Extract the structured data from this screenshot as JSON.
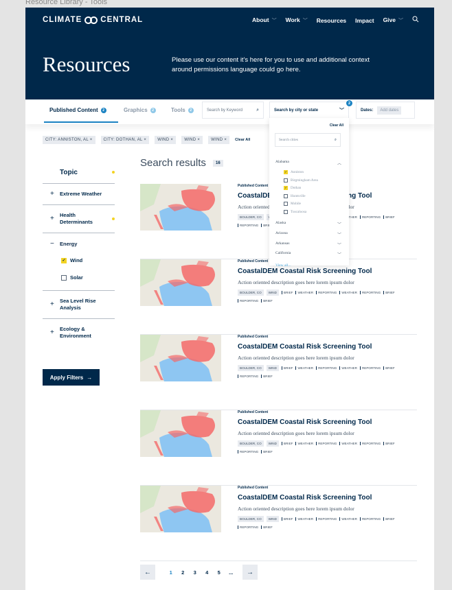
{
  "frame_label": "Resource Library - Tools",
  "header": {
    "logo_left": "CLIMATE",
    "logo_right": "CENTRAL",
    "nav": [
      {
        "label": "About",
        "has_dropdown": true
      },
      {
        "label": "Work",
        "has_dropdown": true
      },
      {
        "label": "Resources",
        "has_dropdown": false
      },
      {
        "label": "Impact",
        "has_dropdown": false
      },
      {
        "label": "Give",
        "has_dropdown": true
      }
    ],
    "search_icon": "search-icon",
    "title": "Resources",
    "description": "Please use our content it's here for you to use and additional context around permissions language could go here."
  },
  "tabs": [
    {
      "label": "Published Content",
      "count": "2",
      "active": true
    },
    {
      "label": "Graphics",
      "count": "2",
      "active": false
    },
    {
      "label": "Tools",
      "count": "2",
      "active": false
    }
  ],
  "filters_bar": {
    "keyword_placeholder": "Search by Keyword",
    "city_label": "Search by city or state",
    "city_count": "2",
    "dates_label": "Dates:",
    "dates_placeholder": "Add dates"
  },
  "active_chips": [
    "CITY: ANNISTON, AL ×",
    "CITY: DOTHAN, AL ×",
    "WIND ×",
    "WIND ×",
    "WIND ×"
  ],
  "clear_all_label": "Clear All",
  "city_dropdown": {
    "clear_all": "Clear All",
    "search_placeholder": "Search cities",
    "expanded_state": "Alabama",
    "cities": [
      {
        "label": "Anniston",
        "checked": true
      },
      {
        "label": "Birgmingham Area",
        "checked": false
      },
      {
        "label": "Dothan",
        "checked": true
      },
      {
        "label": "Huntsville",
        "checked": false
      },
      {
        "label": "Mobile",
        "checked": false
      },
      {
        "label": "Tuscaloosa",
        "checked": false
      }
    ],
    "collapsed_states": [
      "Alaska",
      "Arizona",
      "Arkansas",
      "California"
    ],
    "view_all": "View all..."
  },
  "sidebar": {
    "heading": "Topic",
    "categories": [
      {
        "label": "Extreme Weather",
        "has_selection": false
      },
      {
        "label": "Health Determinants",
        "has_selection": true
      }
    ],
    "energy": {
      "label": "Energy",
      "options": [
        {
          "label": "Wind",
          "checked": true
        },
        {
          "label": "Solar",
          "checked": false
        }
      ]
    },
    "categories_after": [
      {
        "label": "Sea Level Rise Analysis"
      },
      {
        "label": "Ecology & Environment"
      }
    ],
    "apply_label": "Apply Filters"
  },
  "results": {
    "title": "Search results",
    "count": "16",
    "items": [
      {
        "type": "Published Content",
        "title": "CoastalDEM Coastal Risk Screening Tool",
        "description": "Action oriented description goes here lorem ipsum dolor",
        "boxed_tags": [
          "BOULDER, CO",
          "WIND"
        ],
        "line_tags": [
          "BRIEF",
          "WEATHER",
          "REPORTING",
          "WEATHER",
          "REPORTING",
          "BRIEF",
          "REPORTING",
          "BRIEF"
        ]
      },
      {
        "type": "Published Content",
        "title": "CoastalDEM Coastal Risk Screening Tool",
        "description": "Action oriented description goes here lorem ipsum dolor",
        "boxed_tags": [
          "BOULDER, CO",
          "WIND"
        ],
        "line_tags": [
          "BRIEF",
          "WEATHER",
          "REPORTING",
          "WEATHER",
          "REPORTING",
          "BRIEF",
          "REPORTING",
          "BRIEF"
        ]
      },
      {
        "type": "Published Content",
        "title": "CoastalDEM Coastal Risk Screening Tool",
        "description": "Action oriented description goes here lorem ipsum dolor",
        "boxed_tags": [
          "BOULDER, CO",
          "WIND"
        ],
        "line_tags": [
          "BRIEF",
          "WEATHER",
          "REPORTING",
          "WEATHER",
          "REPORTING",
          "BRIEF",
          "REPORTING",
          "BRIEF"
        ]
      },
      {
        "type": "Published Content",
        "title": "CoastalDEM Coastal Risk Screening Tool",
        "description": "Action oriented description goes here lorem ipsum dolor",
        "boxed_tags": [
          "BOULDER, CO",
          "WIND"
        ],
        "line_tags": [
          "BRIEF",
          "WEATHER",
          "REPORTING",
          "WEATHER",
          "REPORTING",
          "BRIEF",
          "REPORTING",
          "BRIEF"
        ]
      },
      {
        "type": "Published Content",
        "title": "CoastalDEM Coastal Risk Screening Tool",
        "description": "Action oriented description goes here lorem ipsum dolor",
        "boxed_tags": [
          "BOULDER, CO",
          "WIND"
        ],
        "line_tags": [
          "BRIEF",
          "WEATHER",
          "REPORTING",
          "WEATHER",
          "REPORTING",
          "BRIEF",
          "REPORTING",
          "BRIEF"
        ]
      }
    ]
  },
  "pagination": {
    "prev": "←",
    "next": "→",
    "pages": [
      "1",
      "2",
      "3",
      "4",
      "5",
      "..."
    ],
    "current": "1"
  },
  "colors": {
    "navy": "#00284a",
    "accent_blue": "#1a82c2",
    "highlight_yellow": "#f3d323",
    "chip_gray": "#e8ebf0"
  }
}
